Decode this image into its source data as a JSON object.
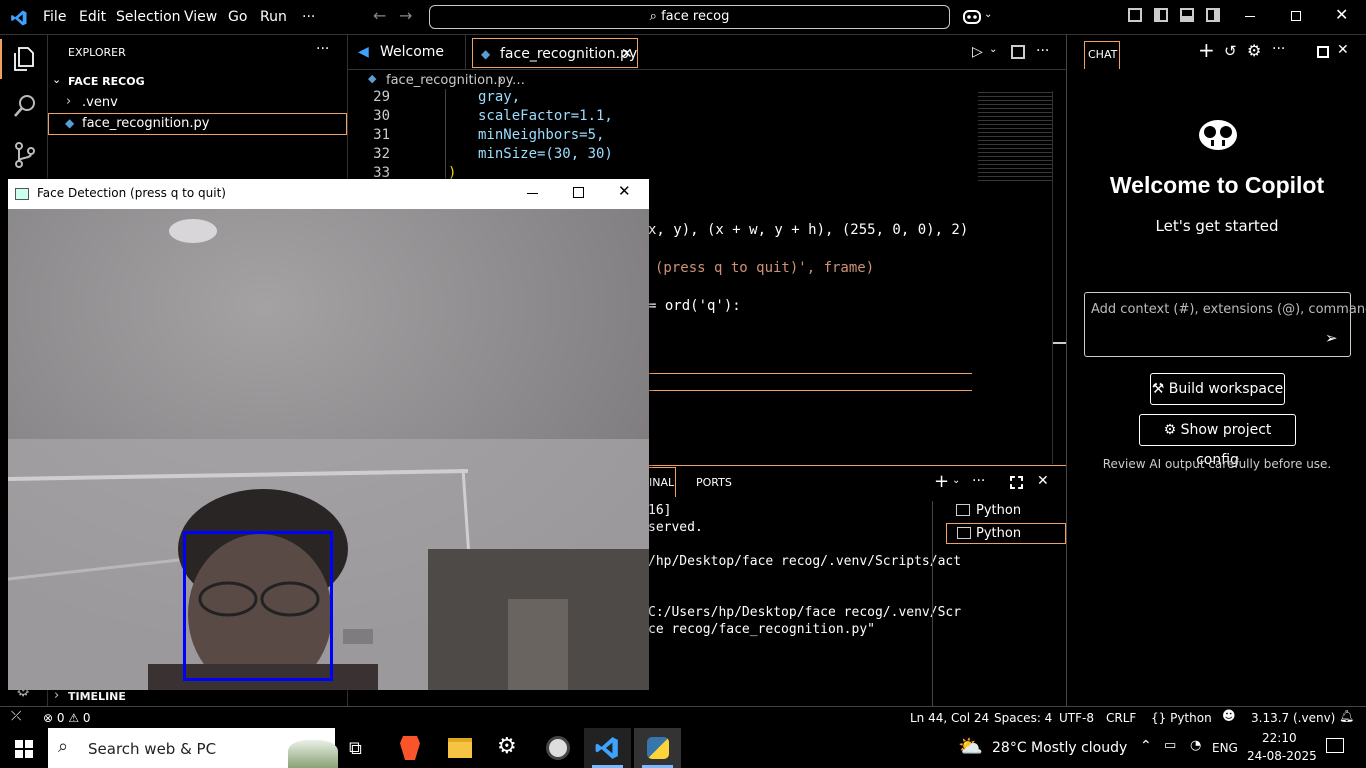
{
  "titlebar": {
    "menu": [
      "File",
      "Edit",
      "Selection",
      "View",
      "Go",
      "Run",
      "···"
    ],
    "search_text": "face recog"
  },
  "explorer": {
    "header": "EXPLORER",
    "folder": "FACE RECOG",
    "items": [
      ".venv",
      "face_recognition.py"
    ],
    "timeline": "TIMELINE"
  },
  "editor": {
    "tabs": [
      "Welcome",
      "face_recognition.py"
    ],
    "breadcrumb_file": "face_recognition.py",
    "breadcrumb_more": "…",
    "lines": [
      {
        "n": "29",
        "t": "gray,"
      },
      {
        "n": "30",
        "t": "scaleFactor=1.1,"
      },
      {
        "n": "31",
        "t": "minNeighbors=5,"
      },
      {
        "n": "32",
        "t": "minSize=(30, 30)"
      },
      {
        "n": "33",
        "t": ")"
      }
    ],
    "visible_fragments": [
      "x, y), (x + w, y + h), (255, 0, 0), 2)",
      "(press q to quit)', frame)",
      "= ord('q'):"
    ]
  },
  "panel": {
    "tabs": [
      "INAL",
      "PORTS"
    ],
    "terminal_lines": [
      "16]",
      "served.",
      "/hp/Desktop/face recog/.venv/Scripts/act",
      "C:/Users/hp/Desktop/face recog/.venv/Scr",
      "ce recog/face_recognition.py\""
    ],
    "terminals": [
      "Python",
      "Python"
    ]
  },
  "chat": {
    "header": "CHAT",
    "title": "Welcome to Copilot",
    "subtitle": "Let's get started",
    "input_placeholder": "Add context (#), extensions (@), commands",
    "build_button": "Build workspace",
    "config_button": "Show project config",
    "disclaimer": "Review AI output carefully before use."
  },
  "camera_window": {
    "title": "Face Detection (press q to quit)"
  },
  "statusbar": {
    "problems": "⊗ 0 ⚠ 0",
    "position": "Ln 44, Col 24",
    "spaces": "Spaces: 4",
    "encoding": "UTF-8",
    "eol": "CRLF",
    "language": "{} Python",
    "interpreter": "3.13.7 (.venv)"
  },
  "taskbar": {
    "search_placeholder": "Search web & PC",
    "weather": "28°C  Mostly cloudy",
    "lang": "ENG",
    "time": "22:10",
    "date": "24-08-2025"
  },
  "colors": {
    "accent": "#0078d4",
    "face_box": "#0000ff",
    "panel_border": "#f0a060"
  }
}
